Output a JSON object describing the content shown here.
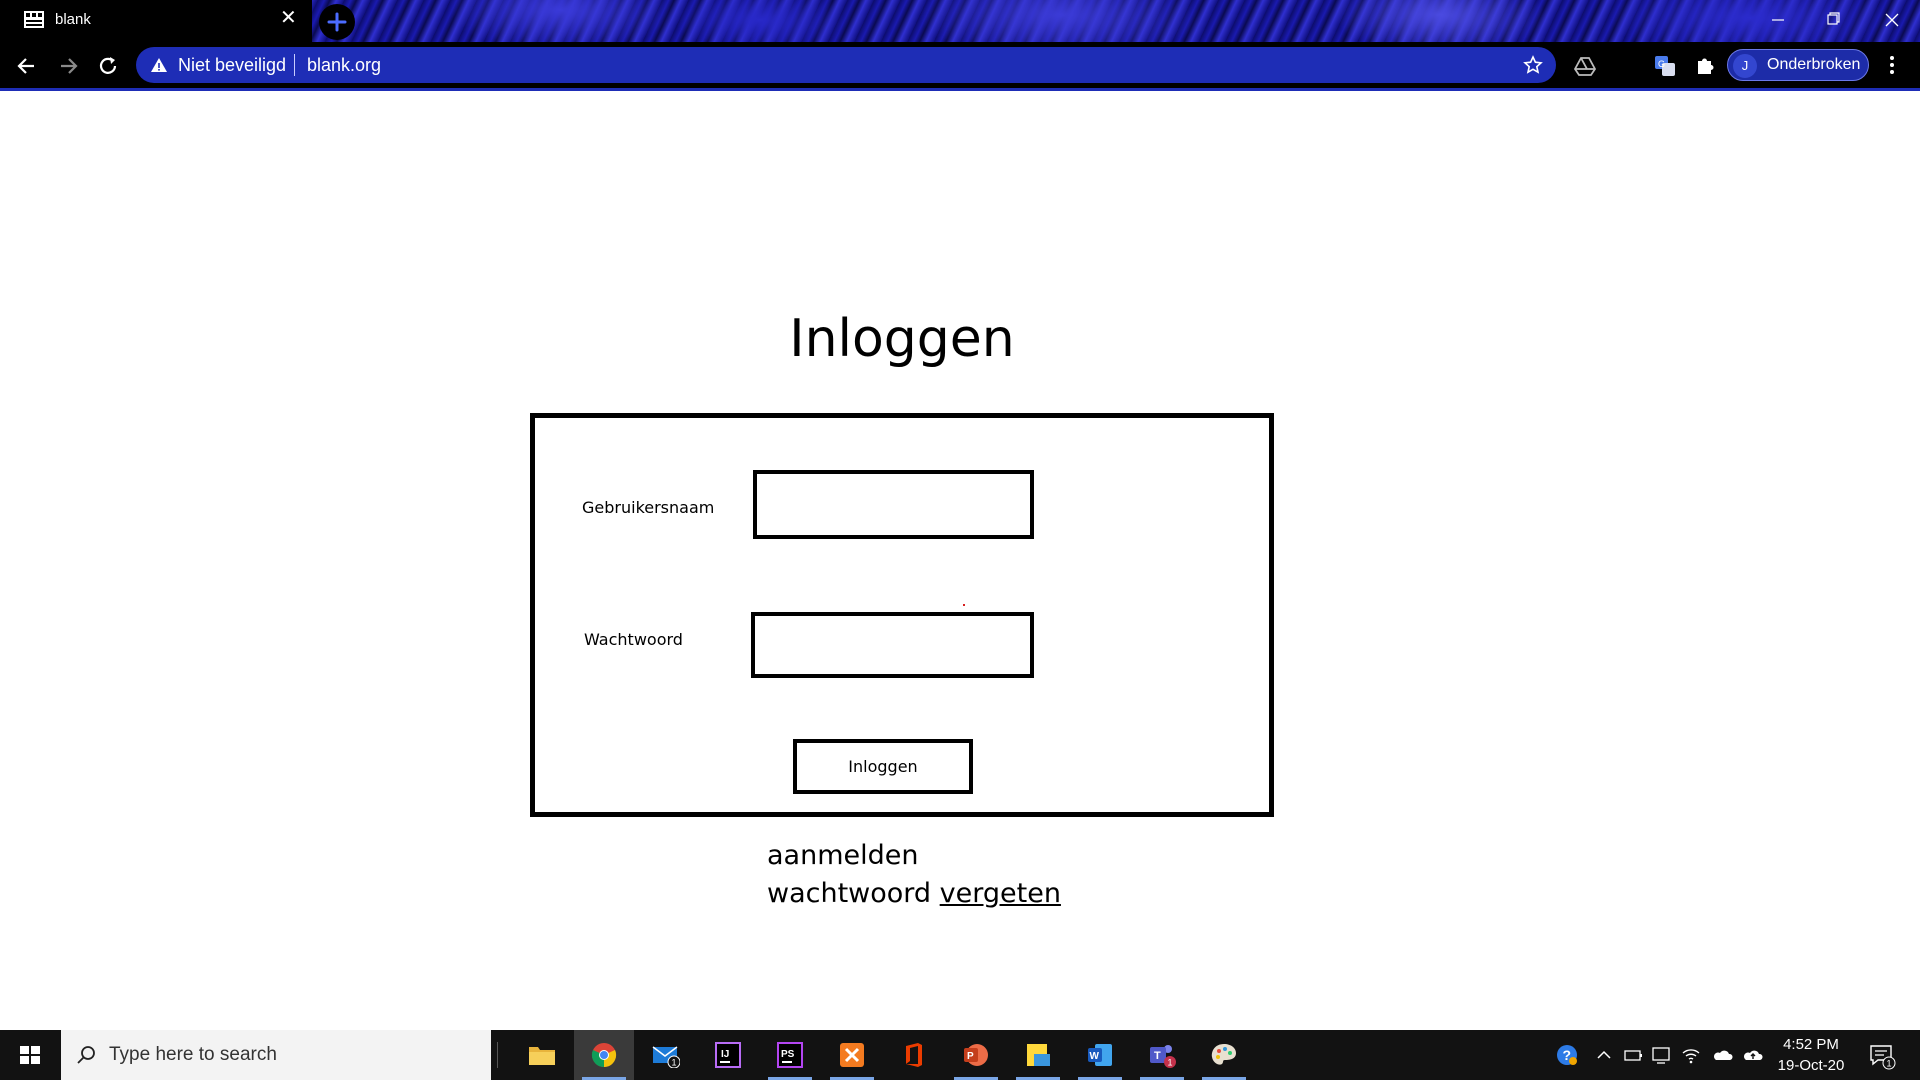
{
  "browser": {
    "tab_title": "blank",
    "security_label": "Niet beveiligd",
    "url": "blank.org",
    "profile_initial": "J",
    "profile_label": "Onderbroken"
  },
  "page": {
    "title": "Inloggen",
    "username_label": "Gebruikersnaam",
    "username_value": "",
    "password_label": "Wachtwoord",
    "password_value": "",
    "submit_label": "Inloggen",
    "signup_link": "aanmelden",
    "forgot_prefix": "wachtwoord",
    "forgot_link": "vergeten"
  },
  "taskbar": {
    "search_placeholder": "Type here to search",
    "apps": [
      "file-explorer",
      "chrome",
      "mail",
      "intellij",
      "phpstorm",
      "xampp",
      "office",
      "powerpoint",
      "sticky-notes",
      "word",
      "teams",
      "paint"
    ],
    "mail_badge": "1",
    "teams_badge": "1",
    "time": "4:52 PM",
    "date": "19-Oct-20",
    "notification_count": "1"
  },
  "colors": {
    "omnibox": "#1e2db6",
    "taskbar": "#121212",
    "page_background": "#ffffff"
  }
}
